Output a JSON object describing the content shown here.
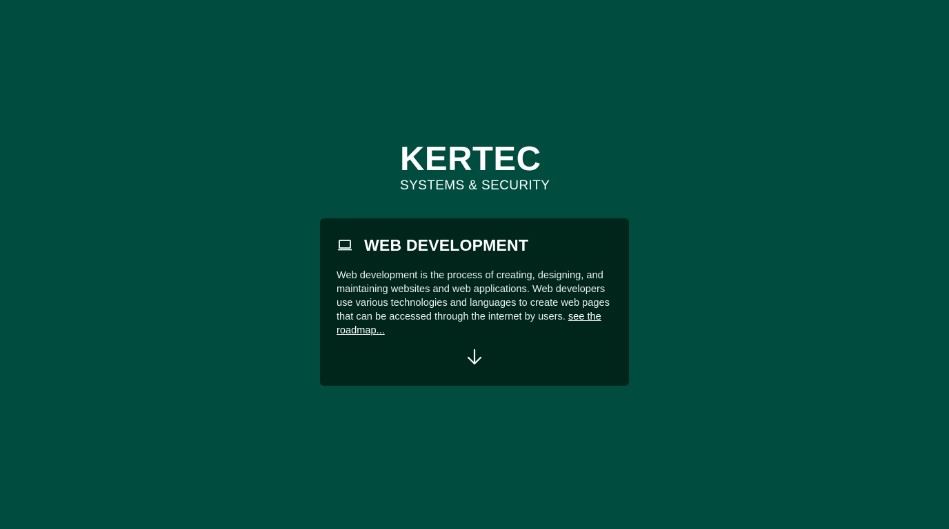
{
  "brand": {
    "title": "KERTEC",
    "subtitle": "SYSTEMS & SECURITY"
  },
  "card": {
    "icon": "laptop-icon",
    "title": "WEB DEVELOPMENT",
    "description": "Web development is the process of creating, designing, and maintaining websites and web applications. Web developers use various technologies and languages to create web pages that can be accessed through the internet by users.",
    "link_label": "see the roadmap...",
    "expand_icon": "arrow-down-icon"
  },
  "colors": {
    "background": "#004d40",
    "card_background": "#00251a",
    "text": "#ffffff"
  }
}
